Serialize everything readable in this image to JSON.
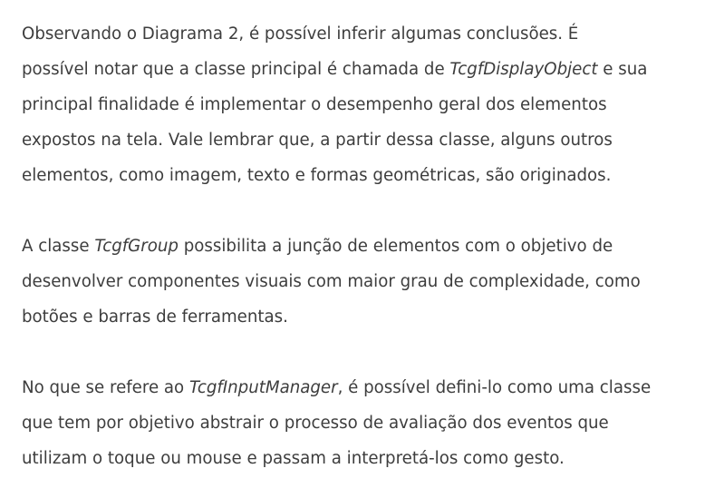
{
  "paragraphs": [
    {
      "lines": [
        [
          {
            "text": "Observando o Diagrama 2, é possível inferir algumas conclusões. É"
          }
        ],
        [
          {
            "text": "possível notar que a classe principal é chamada de "
          },
          {
            "text": "TcgfDisplayObject",
            "italic": true
          },
          {
            "text": " e sua"
          }
        ],
        [
          {
            "text": "principal finalidade é implementar o desempenho geral dos elementos"
          }
        ],
        [
          {
            "text": "expostos na tela. Vale lembrar que, a partir dessa classe, alguns outros"
          }
        ],
        [
          {
            "text": "elementos, como imagem, texto e formas geométricas, são originados."
          }
        ]
      ]
    },
    {
      "lines": [
        [
          {
            "text": "A classe "
          },
          {
            "text": "TcgfGroup",
            "italic": true
          },
          {
            "text": " possibilita a junção de elementos com o objetivo de"
          }
        ],
        [
          {
            "text": "desenvolver componentes visuais com maior grau de complexidade, como"
          }
        ],
        [
          {
            "text": "botões e barras de ferramentas."
          }
        ]
      ]
    },
    {
      "lines": [
        [
          {
            "text": "No que se refere ao "
          },
          {
            "text": "TcgfInputManager",
            "italic": true
          },
          {
            "text": ", é possível defini-lo como uma classe"
          }
        ],
        [
          {
            "text": "que tem por objetivo abstrair o processo de avaliação dos eventos que"
          }
        ],
        [
          {
            "text": "utilizam o toque ou mouse e passam a interpretá-los como gesto."
          }
        ]
      ]
    }
  ],
  "colors": {
    "text": "#3d3d3d",
    "background": "#ffffff"
  }
}
